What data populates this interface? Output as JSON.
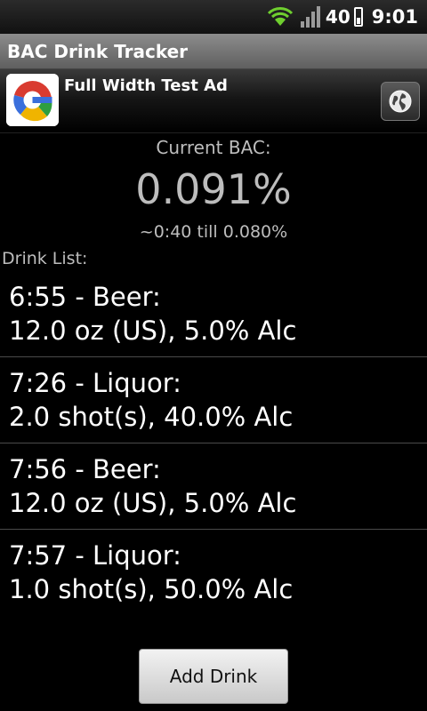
{
  "status_bar": {
    "battery_level": "40",
    "time": "9:01"
  },
  "title_bar": {
    "title": "BAC Drink Tracker"
  },
  "ad": {
    "text": "Full Width Test Ad"
  },
  "bac": {
    "label": "Current BAC:",
    "value": "0.091%",
    "projection": "~0:40 till 0.080%"
  },
  "drink_list": {
    "label": "Drink List:",
    "items": [
      {
        "line1": "6:55 - Beer:",
        "line2": "12.0 oz (US), 5.0% Alc"
      },
      {
        "line1": "7:26 - Liquor:",
        "line2": "2.0 shot(s), 40.0% Alc"
      },
      {
        "line1": "7:56 - Beer:",
        "line2": "12.0 oz (US), 5.0% Alc"
      },
      {
        "line1": "7:57 - Liquor:",
        "line2": "1.0 shot(s), 50.0% Alc"
      }
    ]
  },
  "actions": {
    "add_drink_label": "Add Drink"
  },
  "icons": {
    "wifi": "wifi-icon",
    "signal": "signal-icon",
    "battery": "battery-icon",
    "ad_logo": "google-logo-icon",
    "globe": "globe-icon"
  }
}
